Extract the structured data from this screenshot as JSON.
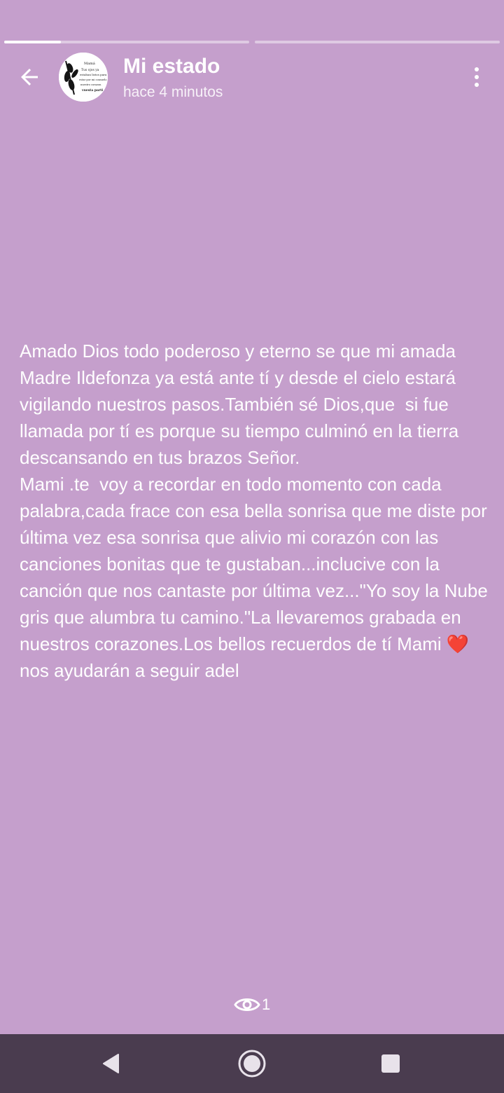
{
  "status": {
    "segments": [
      {
        "progress": 0.23
      },
      {
        "progress": 0.0
      }
    ],
    "title": "Mi estado",
    "time": "hace 4 minutos",
    "text": "Amado Dios todo poderoso y eterno se que mi amada Madre Ildefonza ya está ante tí y desde el cielo estará vigilando nuestros pasos.También sé Dios,que  si fue llamada por tí es porque su tiempo culminó en la tierra descansando en tus brazos Señor.\nMami .te  voy a recordar en todo momento con cada palabra,cada frace con esa bella sonrisa que me diste por última vez esa sonrisa que alivio mi corazón con las canciones bonitas que te gustaban...inclucive con la canción que nos cantaste por última vez...\"Yo soy la Nube gris que alumbra tu camino.\"La llevaremos grabada en nuestros corazones.Los bellos recuerdos de tí Mami ❤️nos ayudarán a seguir adel",
    "views": "1"
  },
  "avatar": {
    "lines": [
      "Mamá",
      "Tus ojos ya",
      "estaban listos para",
      "estar por mi consuelo",
      "nuestro corazon",
      "vuesta parti"
    ]
  },
  "colors": {
    "background": "#c59fcc",
    "nav_bar": "#4a3c4f",
    "text": "#ffffff"
  },
  "icons": {
    "back": "arrow-back-icon",
    "menu": "more-vert-icon",
    "views": "eye-icon",
    "nav_back": "triangle-back-icon",
    "nav_home": "circle-home-icon",
    "nav_recent": "square-recent-icon"
  }
}
